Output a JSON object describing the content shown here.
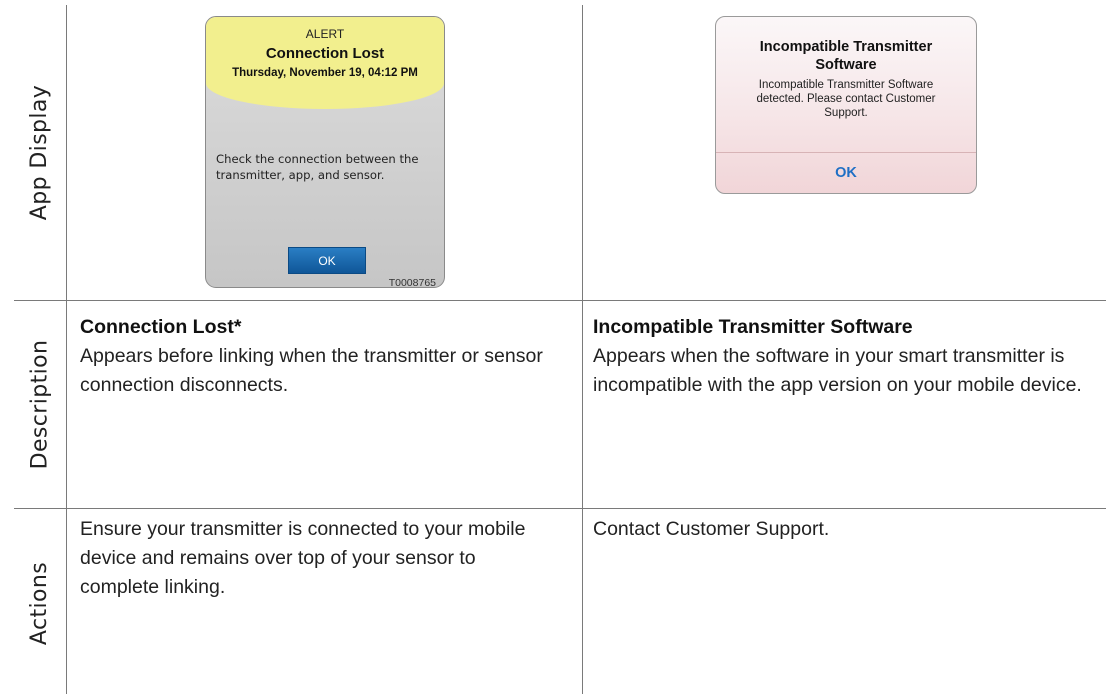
{
  "rows": {
    "app_display_label": "App Display",
    "description_label": "Description",
    "actions_label": "Actions"
  },
  "connection_lost_alert": {
    "header": "ALERT",
    "title": "Connection Lost",
    "datetime": "Thursday, November 19, 04:12 PM",
    "message": "Check the connection between the transmitter, app, and sensor.",
    "ok_label": "OK",
    "code": "T0008765",
    "colors": {
      "band": "#f2ef8e",
      "button": "#1c6aad"
    }
  },
  "incompatible_alert": {
    "title": "Incompatible Transmitter Software",
    "message": "Incompatible Transmitter Software detected. Please contact Customer Support.",
    "ok_label": "OK",
    "colors": {
      "ok_text": "#1f6fc5",
      "tint": "#f1d5d8"
    }
  },
  "descriptions": [
    {
      "heading": "Connection Lost*",
      "text": "Appears before linking when the transmitter or sensor connection disconnects."
    },
    {
      "heading": "Incompatible Transmitter Software",
      "text": "Appears when the software in your smart transmitter is incompatible with the app version on your mobile device."
    }
  ],
  "actions": [
    {
      "text": "Ensure your transmitter is connected to your mobile device and remains over top of your sensor to complete linking."
    },
    {
      "text": "Contact Customer Support."
    }
  ]
}
